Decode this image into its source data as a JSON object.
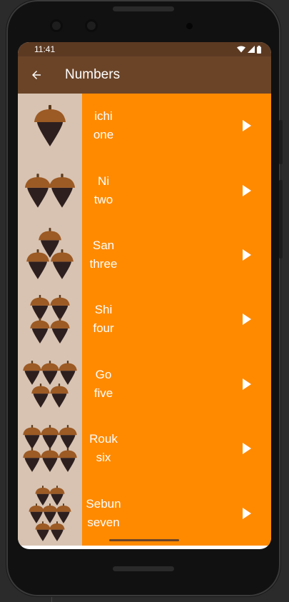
{
  "statusbar": {
    "time": "11:41"
  },
  "appbar": {
    "title": "Numbers"
  },
  "icons": {
    "back": "arrow-back-icon",
    "play": "play-icon",
    "acorn": "acorn-icon",
    "wifi": "wifi-icon",
    "signal": "signal-icon",
    "battery": "battery-icon"
  },
  "colors": {
    "appbar": "#6b4428",
    "statusbar": "#5c3a22",
    "row": "#ff8a00",
    "image_bg": "#d8c3b2"
  },
  "numbers": [
    {
      "japanese": "ichi",
      "english": "one",
      "acorns": 1
    },
    {
      "japanese": "Ni",
      "english": "two",
      "acorns": 2
    },
    {
      "japanese": "San",
      "english": "three",
      "acorns": 3
    },
    {
      "japanese": "Shi",
      "english": "four",
      "acorns": 4
    },
    {
      "japanese": "Go",
      "english": "five",
      "acorns": 5
    },
    {
      "japanese": "Rouk",
      "english": "six",
      "acorns": 6
    },
    {
      "japanese": "Sebun",
      "english": "seven",
      "acorns": 7
    }
  ]
}
